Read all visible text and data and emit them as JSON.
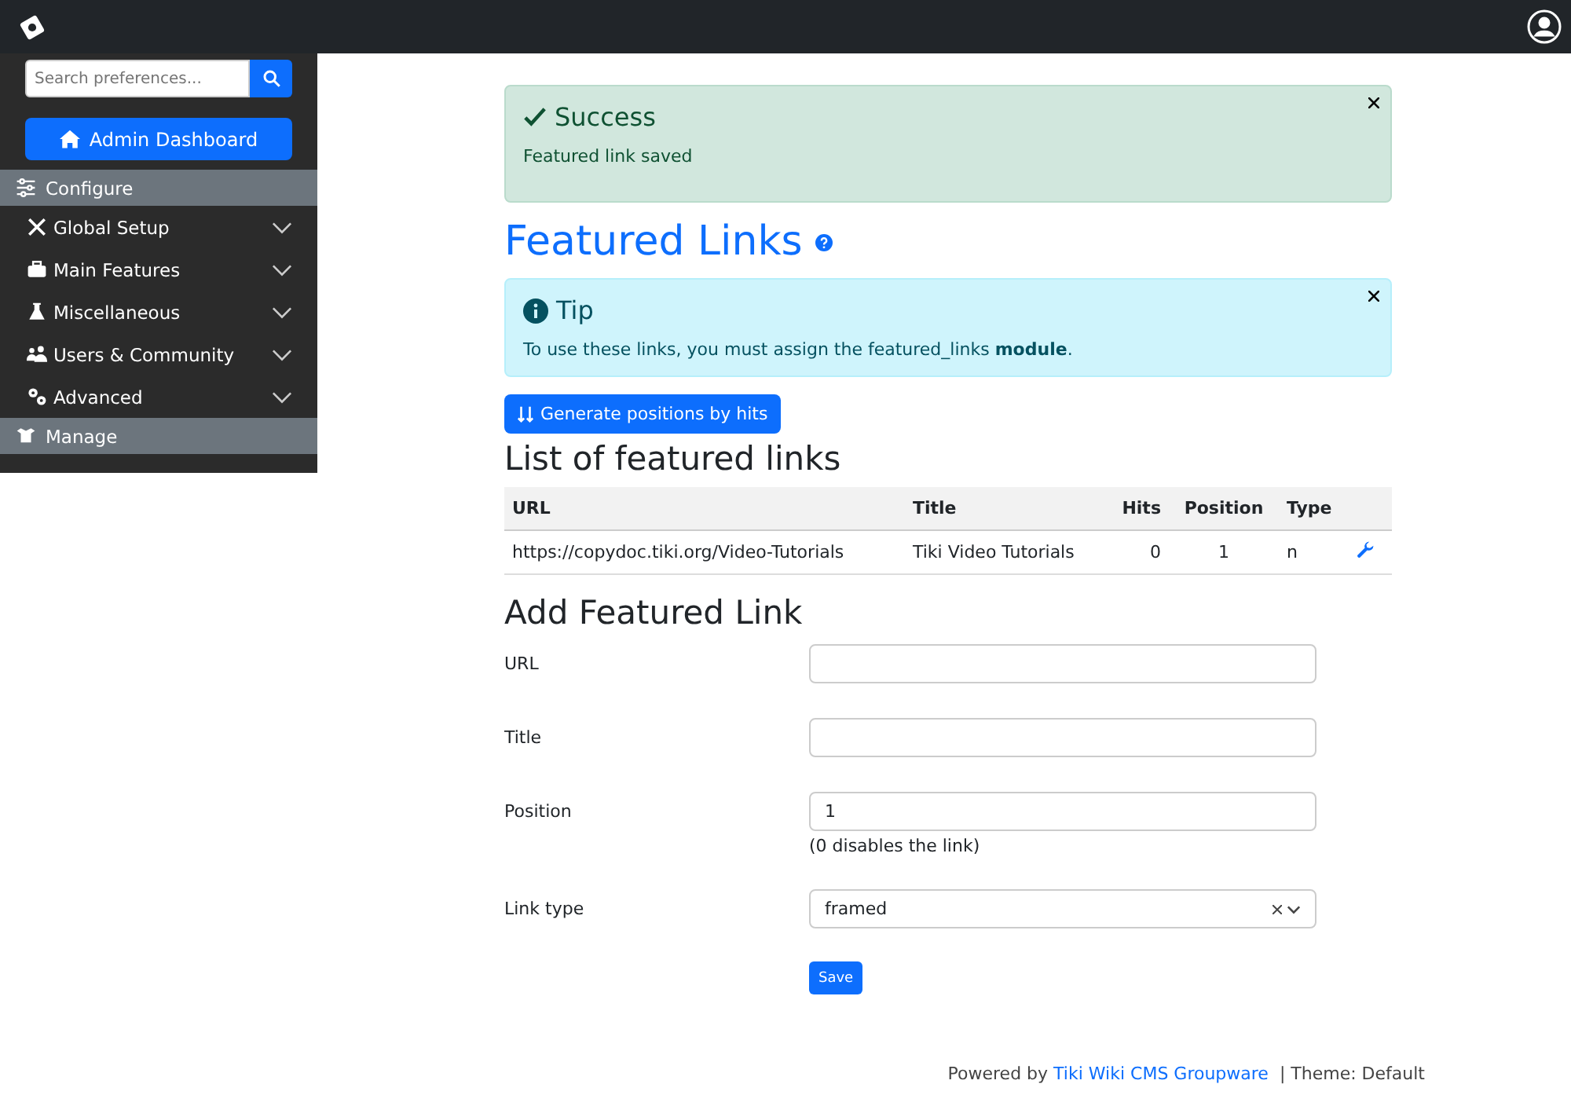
{
  "sidebar": {
    "search": {
      "placeholder": "Search preferences..."
    },
    "dashboard_button": "Admin Dashboard",
    "sections": [
      {
        "label": "Configure",
        "items": [
          {
            "label": "Global Setup",
            "expanded": false
          },
          {
            "label": "Main Features",
            "expanded": false
          },
          {
            "label": "Miscellaneous",
            "expanded": false
          },
          {
            "label": "Users & Community",
            "expanded": false
          },
          {
            "label": "Advanced",
            "expanded": false
          }
        ]
      },
      {
        "label": "Manage"
      }
    ]
  },
  "alerts": [
    {
      "kind": "success",
      "title": "Success",
      "text": "Featured link saved"
    }
  ],
  "page_title": "Featured Links",
  "tip": {
    "kind": "info",
    "title": "Tip",
    "text": "To use these links, you must assign the featured_links **module**."
  },
  "generate_button": "Generate positions by hits",
  "list_heading": "List of featured links",
  "table": {
    "columns": [
      "URL",
      "Title",
      "Hits",
      "Position",
      "Type"
    ],
    "rows": [
      {
        "cells": [
          "https://copydoc.tiki.org/Video-Tutorials",
          "Tiki Video Tutorials",
          "0",
          "1",
          "n"
        ]
      }
    ]
  },
  "form": {
    "heading": "Add Featured Link",
    "fields": [
      {
        "label": "URL",
        "kind": "text"
      },
      {
        "label": "Title",
        "kind": "text"
      },
      {
        "label": "Position",
        "kind": "text",
        "value": "1",
        "hint": "(0 disables the link)"
      },
      {
        "label": "Link type",
        "kind": "select",
        "value": "framed"
      }
    ],
    "save_button": "Save"
  },
  "footer": {
    "prefix": "Powered by",
    "link": "Tiki Wiki CMS Groupware",
    "suffix": "| Theme: Default"
  }
}
